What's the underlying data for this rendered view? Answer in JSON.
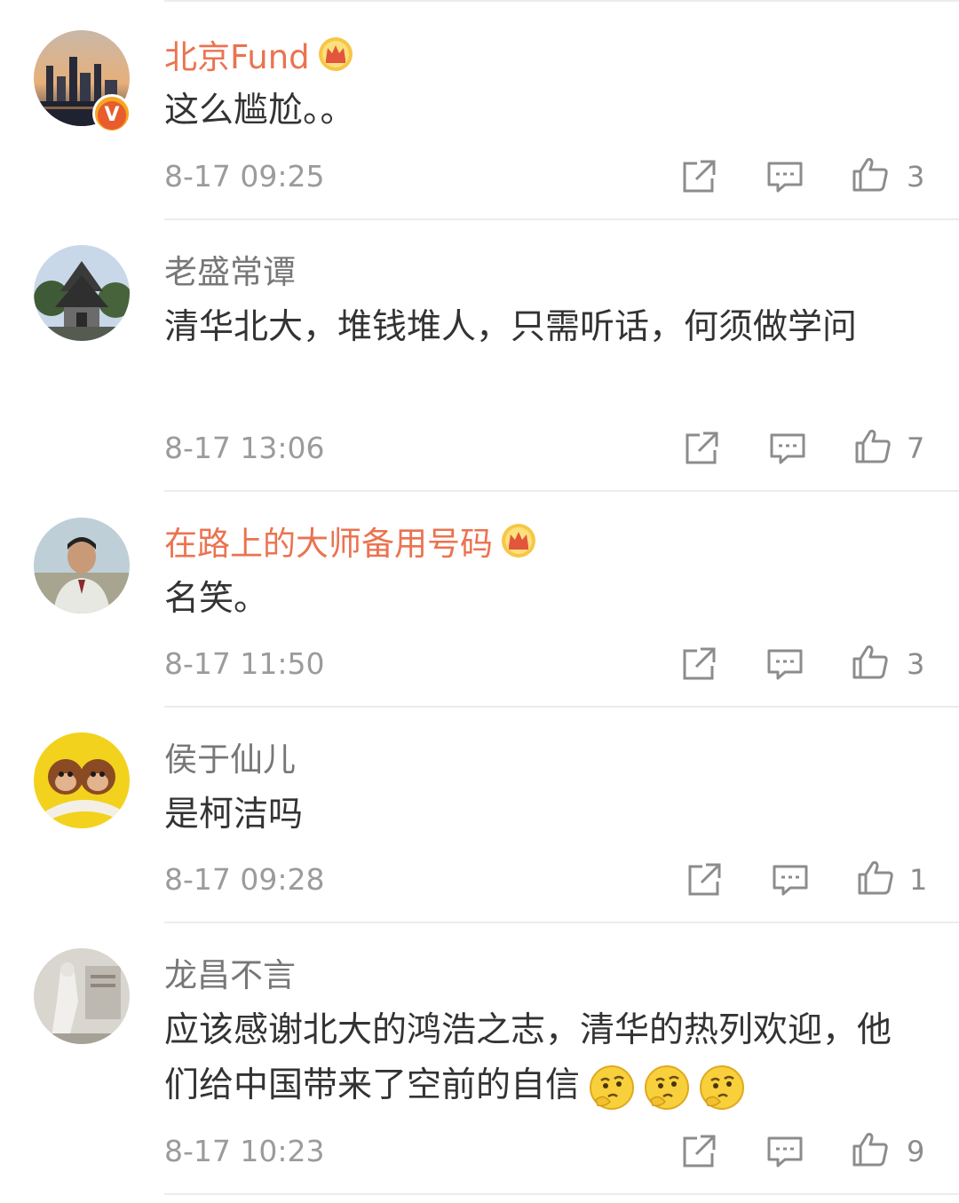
{
  "comments": [
    {
      "name": "北京Fund",
      "vip": true,
      "verified": true,
      "text": "这么尴尬。。",
      "time": "8-17 09:25",
      "likes": "3",
      "avatar": "city-skyline-avatar"
    },
    {
      "name": "老盛常谭",
      "vip": false,
      "verified": false,
      "text": "清华北大，堆钱堆人，只需听话，何须做学问",
      "time": "8-17 13:06",
      "likes": "7",
      "avatar": "temple-avatar"
    },
    {
      "name": "在路上的大师备用号码",
      "vip": true,
      "verified": false,
      "text": "名笑。",
      "time": "8-17 11:50",
      "likes": "3",
      "avatar": "man-portrait-avatar"
    },
    {
      "name": "侯于仙儿",
      "vip": false,
      "verified": false,
      "text": "是柯洁吗",
      "time": "8-17 09:28",
      "likes": "1",
      "avatar": "monkeys-avatar"
    },
    {
      "name": "龙昌不言",
      "vip": false,
      "verified": false,
      "text": "应该感谢北大的鸿浩之志，清华的热列欢迎，他们给中国带来了空前的自信",
      "emoji_count": 3,
      "time": "8-17 10:23",
      "likes": "9",
      "avatar": "statue-avatar"
    }
  ],
  "icons": {
    "share": "share-icon",
    "comment": "comment-icon",
    "like": "like-icon",
    "vip": "crown-icon",
    "verified": "verified-badge-icon",
    "emoji": "thinking-emoji-icon"
  },
  "colors": {
    "vip_name": "#eb7350",
    "name": "#777777",
    "text": "#333333",
    "meta": "#9b9b9b"
  }
}
